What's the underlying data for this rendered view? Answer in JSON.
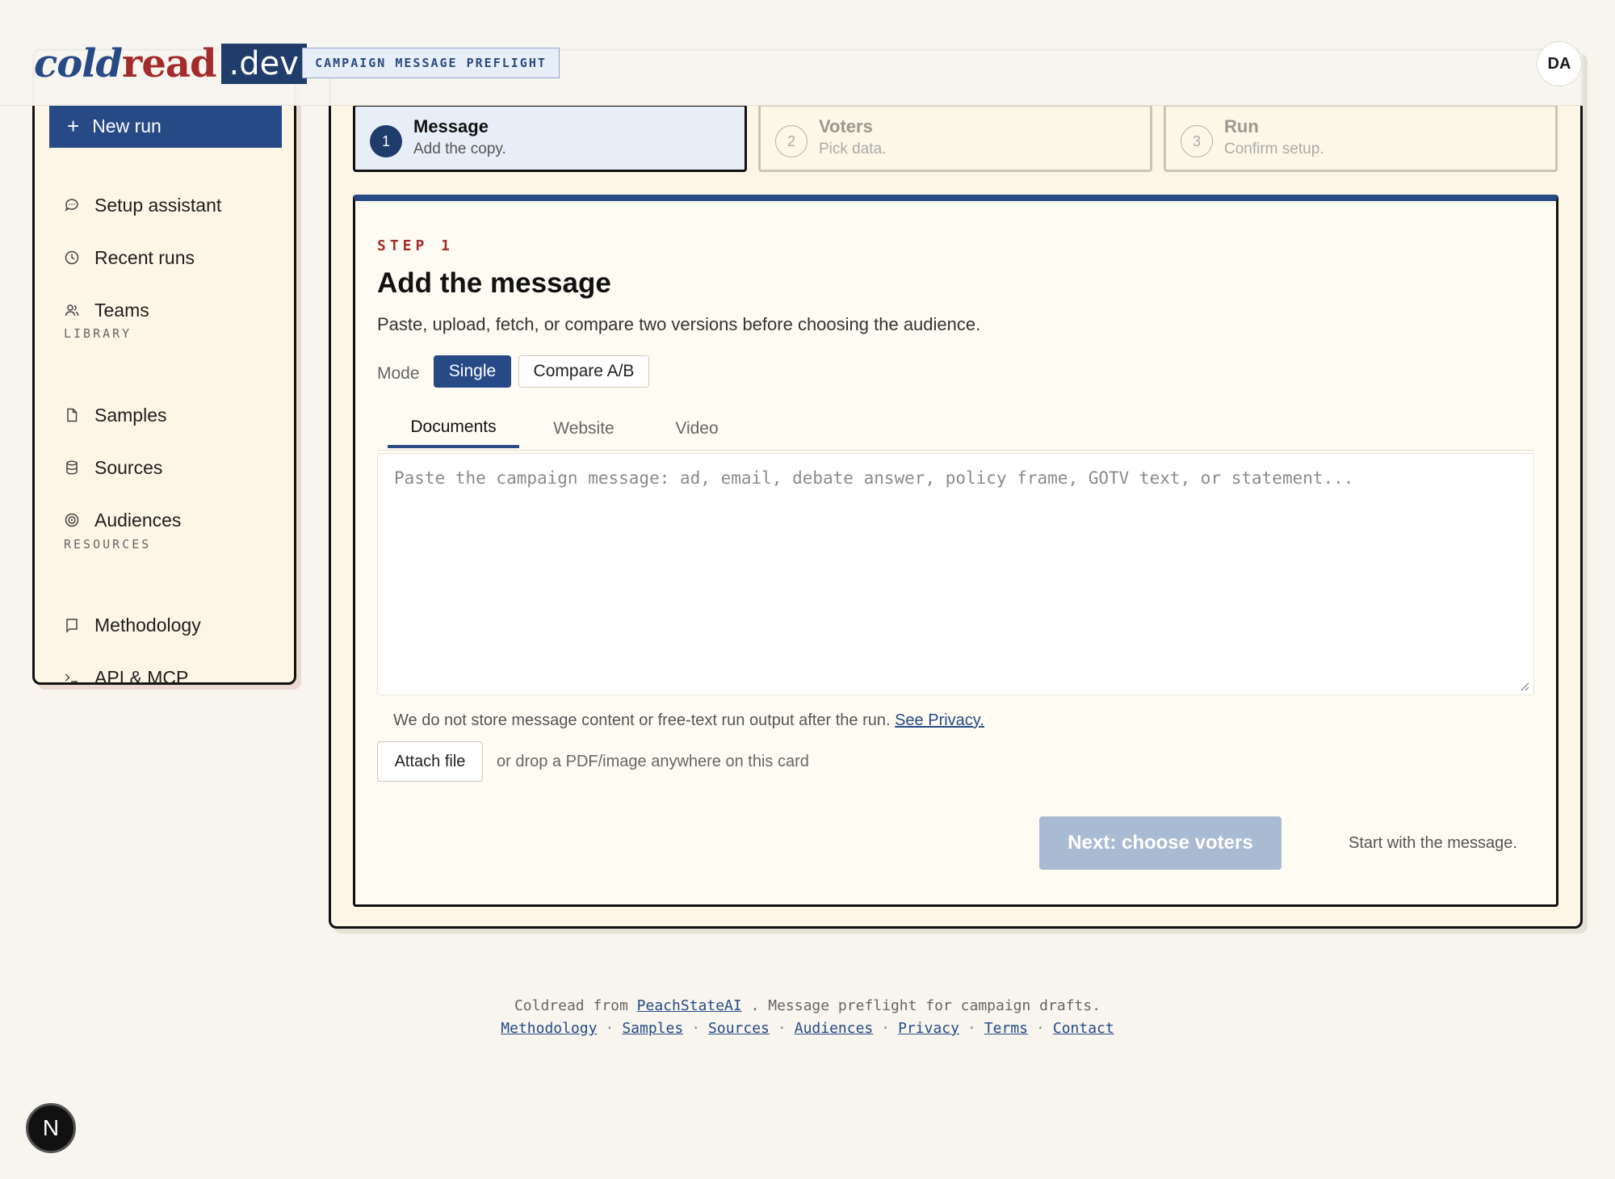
{
  "header": {
    "logo_cold": "cold",
    "logo_read": "read",
    "logo_dev": ".dev",
    "badge": "CAMPAIGN MESSAGE PREFLIGHT",
    "avatar": "DA"
  },
  "sidebar": {
    "new_run": "New run",
    "items": [
      {
        "label": "Setup assistant",
        "icon": "chat-bubble-icon"
      },
      {
        "label": "Recent runs",
        "icon": "clock-icon"
      },
      {
        "label": "Teams",
        "icon": "users-icon"
      }
    ],
    "library_heading": "LIBRARY",
    "library": [
      {
        "label": "Samples",
        "icon": "file-icon"
      },
      {
        "label": "Sources",
        "icon": "database-icon"
      },
      {
        "label": "Audiences",
        "icon": "target-icon"
      }
    ],
    "resources_heading": "RESOURCES",
    "resources": [
      {
        "label": "Methodology",
        "icon": "book-icon"
      },
      {
        "label": "API & MCP",
        "icon": "terminal-icon"
      }
    ]
  },
  "steps": [
    {
      "num": "1",
      "title": "Message",
      "sub": "Add the copy."
    },
    {
      "num": "2",
      "title": "Voters",
      "sub": "Pick data."
    },
    {
      "num": "3",
      "title": "Run",
      "sub": "Confirm setup."
    }
  ],
  "card": {
    "eyebrow": "STEP 1",
    "title": "Add the message",
    "lead": "Paste, upload, fetch, or compare two versions before choosing the audience.",
    "mode_label": "Mode",
    "mode_single": "Single",
    "mode_compare": "Compare A/B",
    "tabs": [
      "Documents",
      "Website",
      "Video"
    ],
    "textarea_value": "",
    "textarea_placeholder": "Paste the campaign message: ad, email, debate answer, policy frame, GOTV text, or statement...",
    "privacy_text": "We do not store message content or free-text run output after the run.",
    "privacy_link": "See Privacy.",
    "attach": "Attach file",
    "drop": "or drop a PDF/image anywhere on this card",
    "next": "Next: choose voters",
    "hint": "Start with the message."
  },
  "footer": {
    "line1_a": "Coldread from",
    "line1_link": "PeachStateAI",
    "line1_b": ". Message preflight for campaign drafts.",
    "links": [
      "Methodology",
      "Samples",
      "Sources",
      "Audiences",
      "Privacy",
      "Terms",
      "Contact"
    ]
  },
  "fab": "N",
  "colors": {
    "accent": "#274a86",
    "brand_red": "#a42b2b",
    "bg": "#f7f5ee"
  }
}
